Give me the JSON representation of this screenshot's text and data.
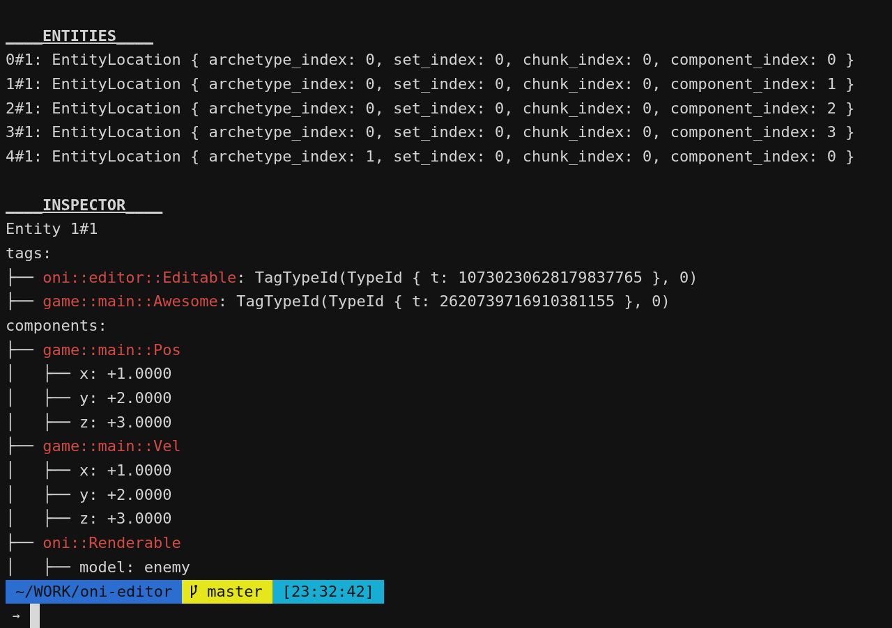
{
  "entities": {
    "heading": "____ENTITIES____",
    "rows": [
      "0#1: EntityLocation { archetype_index: 0, set_index: 0, chunk_index: 0, component_index: 0 }",
      "1#1: EntityLocation { archetype_index: 0, set_index: 0, chunk_index: 0, component_index: 1 }",
      "2#1: EntityLocation { archetype_index: 0, set_index: 0, chunk_index: 0, component_index: 2 }",
      "3#1: EntityLocation { archetype_index: 0, set_index: 0, chunk_index: 0, component_index: 3 }",
      "4#1: EntityLocation { archetype_index: 1, set_index: 0, chunk_index: 0, component_index: 0 }"
    ]
  },
  "inspector": {
    "heading": "____INSPECTOR____",
    "entity": "Entity 1#1",
    "tags_label": "tags:",
    "tags": [
      {
        "branch": "├──",
        "name": "oni::editor::Editable",
        "value": ": TagTypeId(TypeId { t: 10730230628179837765 }, 0)"
      },
      {
        "branch": "├──",
        "name": "game::main::Awesome",
        "value": ": TagTypeId(TypeId { t: 2620739716910381155 }, 0)"
      }
    ],
    "components_label": "components:",
    "components": [
      {
        "branch": "├──",
        "name": "game::main::Pos",
        "children": [
          {
            "branch": "│   ├──",
            "text": "x: +1.0000"
          },
          {
            "branch": "│   ├──",
            "text": "y: +2.0000"
          },
          {
            "branch": "│   ├──",
            "text": "z: +3.0000"
          }
        ]
      },
      {
        "branch": "├──",
        "name": "game::main::Vel",
        "children": [
          {
            "branch": "│   ├──",
            "text": "x: +1.0000"
          },
          {
            "branch": "│   ├──",
            "text": "y: +2.0000"
          },
          {
            "branch": "│   ├──",
            "text": "z: +3.0000"
          }
        ]
      },
      {
        "branch": "├──",
        "name": "oni::Renderable",
        "children": [
          {
            "branch": "│   ├──",
            "text": "model: enemy"
          }
        ]
      }
    ]
  },
  "prompt": {
    "path": "~/WORK/oni-editor",
    "branch": "master",
    "time": "[23:32:42]",
    "arrow": "→"
  }
}
